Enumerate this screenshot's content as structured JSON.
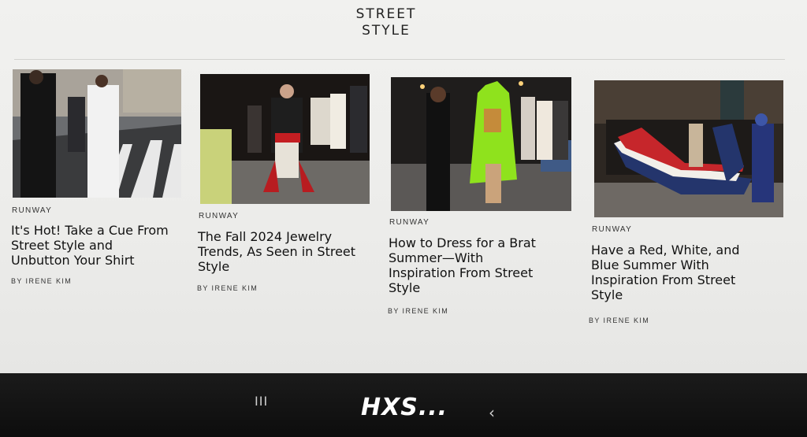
{
  "section": {
    "title_line1": "STREET",
    "title_line2": "STYLE"
  },
  "articles": [
    {
      "kicker": "RUNWAY",
      "title": "It's Hot! Take a Cue From\nStreet Style and\nUnbutton Your Shirt",
      "byline": "BY IRENE KIM",
      "image_desc": "street-crosswalk-photo"
    },
    {
      "kicker": "RUNWAY",
      "title": "The Fall 2024 Jewelry\nTrends, As Seen in Street\nStyle",
      "byline": "BY IRENE KIM",
      "image_desc": "night-crowd-photo"
    },
    {
      "kicker": "RUNWAY",
      "title": "How to Dress for a Brat\nSummer—With\nInspiration From Street\nStyle",
      "byline": "BY IRENE KIM",
      "image_desc": "neon-green-cape-photo"
    },
    {
      "kicker": "RUNWAY",
      "title": "Have a Red, White, and\nBlue Summer With\nInspiration From Street\nStyle",
      "byline": "BY IRENE KIM",
      "image_desc": "tricolor-flag-photo"
    }
  ],
  "navbar": {
    "recents_glyph": "III",
    "back_glyph": "‹"
  },
  "watermark": "HXS..."
}
